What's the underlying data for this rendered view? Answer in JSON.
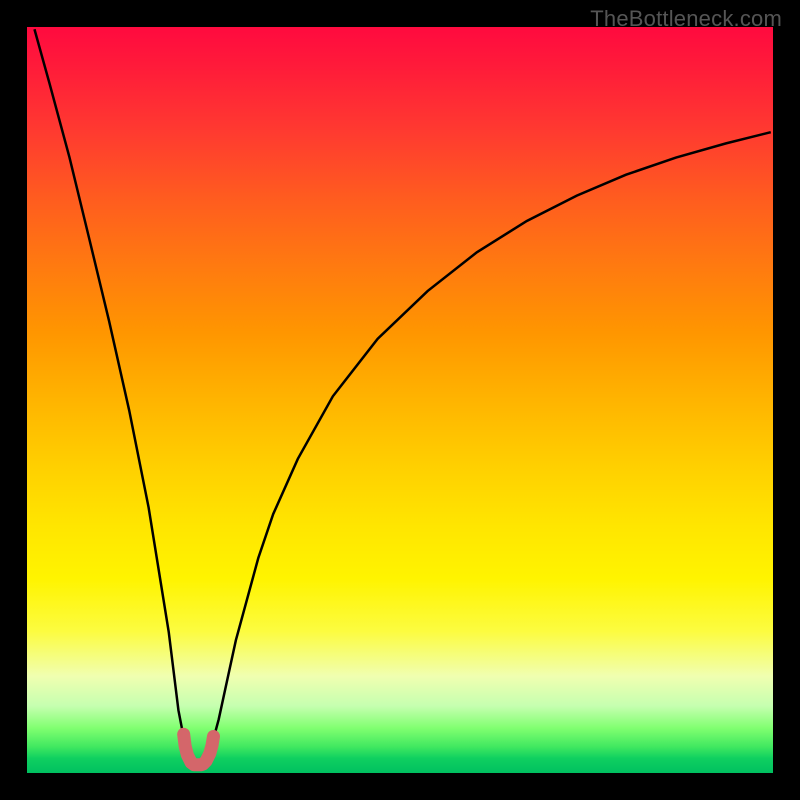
{
  "watermark": "TheBottleneck.com",
  "chart_data": {
    "type": "line",
    "title": "",
    "xlabel": "",
    "ylabel": "",
    "xlim": [
      0,
      100
    ],
    "ylim": [
      0,
      100
    ],
    "grid": false,
    "legend": false,
    "series": [
      {
        "name": "curve-left",
        "x": [
          1.0,
          3.0,
          5.7,
          8.3,
          11.0,
          13.7,
          16.3,
          19.0,
          20.3,
          20.9,
          21.6,
          22.3,
          23.0
        ],
        "y": [
          99.7,
          92.5,
          82.5,
          71.8,
          60.6,
          48.6,
          35.6,
          18.9,
          8.4,
          5.3,
          3.1,
          1.8,
          1.1
        ]
      },
      {
        "name": "curve-right",
        "x": [
          23.0,
          23.7,
          24.3,
          25.0,
          25.7,
          27.0,
          28.0,
          31.0,
          33.0,
          36.3,
          41.0,
          47.0,
          53.7,
          60.3,
          67.0,
          73.7,
          80.3,
          87.0,
          93.7,
          99.7
        ],
        "y": [
          1.1,
          1.7,
          2.8,
          4.6,
          7.2,
          13.2,
          17.8,
          28.8,
          34.7,
          42.1,
          50.5,
          58.2,
          64.6,
          69.8,
          74.0,
          77.4,
          80.2,
          82.5,
          84.4,
          85.9
        ]
      },
      {
        "name": "marker-segment",
        "x": [
          21.0,
          21.2,
          21.5,
          22.0,
          22.4,
          22.7,
          23.0,
          23.3,
          23.6,
          24.0,
          24.5,
          24.8,
          25.0
        ],
        "y": [
          5.2,
          3.6,
          2.4,
          1.4,
          1.1,
          1.1,
          1.1,
          1.1,
          1.2,
          1.6,
          2.6,
          3.7,
          4.9
        ]
      }
    ],
    "marker_style": {
      "color": "#d4666a",
      "stroke_width": 12,
      "linecap": "round"
    },
    "curve_style": {
      "color": "#000000",
      "stroke_width": 2.5
    }
  }
}
